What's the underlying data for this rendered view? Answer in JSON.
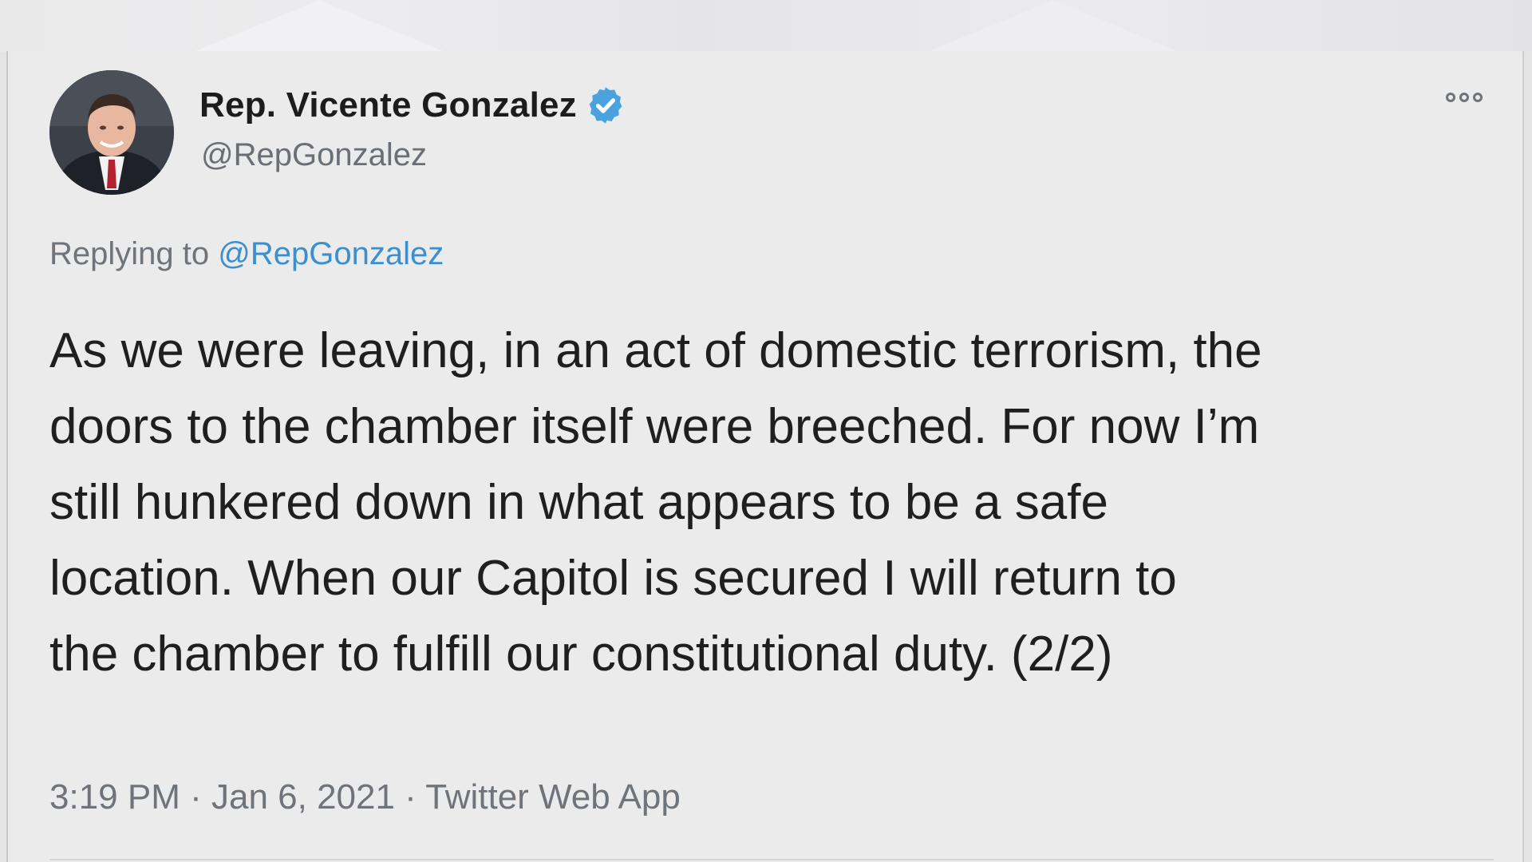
{
  "tweet": {
    "display_name": "Rep. Vicente Gonzalez",
    "handle": "@RepGonzalez",
    "verified": true,
    "replying_prefix": "Replying to ",
    "replying_to": "@RepGonzalez",
    "text": "As we were leaving, in an act of domestic terrorism, the\ndoors to the chamber itself were breeched. For now I’m\nstill hunkered down in what appears to be a safe\nlocation.  When our Capitol is secured I will return to\nthe chamber to fulfill our constitutional duty. (2/2)",
    "time": "3:19 PM",
    "date": "Jan 6, 2021",
    "source": "Twitter Web App",
    "separator": " · "
  },
  "icons": {
    "verified": "verified-badge-icon",
    "more": "more-options-icon"
  },
  "colors": {
    "accent": "#3c8fcf",
    "verified_badge": "#4aa3df",
    "text_primary": "#1f1f1f",
    "text_secondary": "#6f747a",
    "background": "#ebebeb"
  }
}
